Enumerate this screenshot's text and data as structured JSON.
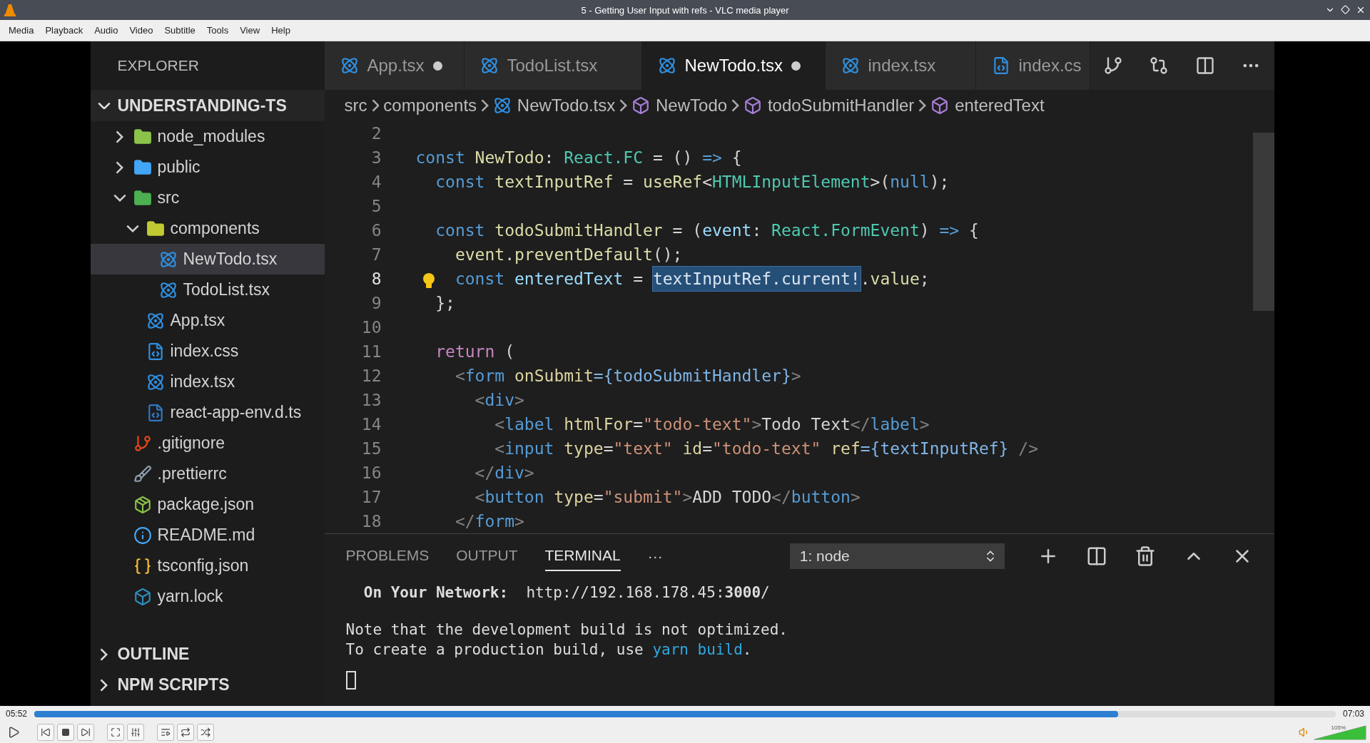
{
  "window": {
    "title": "5 - Getting User Input with refs - VLC media player"
  },
  "menu": [
    "Media",
    "Playback",
    "Audio",
    "Video",
    "Subtitle",
    "Tools",
    "View",
    "Help"
  ],
  "editor": {
    "sidebar": {
      "title": "EXPLORER",
      "root": {
        "label": "UNDERSTANDING-TS",
        "expanded": true,
        "children": [
          {
            "label": "node_modules",
            "kind": "folder",
            "color": "#8bc34a",
            "expanded": false,
            "selected": false
          },
          {
            "label": "public",
            "kind": "folder",
            "color": "#42a5f5",
            "expanded": false,
            "selected": false
          },
          {
            "label": "src",
            "kind": "folder",
            "color": "#4caf50",
            "expanded": true,
            "selected": false,
            "children": [
              {
                "label": "components",
                "kind": "folder",
                "color": "#c0ca33",
                "expanded": true,
                "selected": false,
                "children": [
                  {
                    "label": "NewTodo.tsx",
                    "kind": "react",
                    "selected": true
                  },
                  {
                    "label": "TodoList.tsx",
                    "kind": "react",
                    "selected": false
                  }
                ]
              },
              {
                "label": "App.tsx",
                "kind": "react",
                "selected": false
              },
              {
                "label": "index.css",
                "kind": "css",
                "selected": false
              },
              {
                "label": "index.tsx",
                "kind": "react",
                "selected": false
              },
              {
                "label": "react-app-env.d.ts",
                "kind": "ts",
                "selected": false
              }
            ]
          },
          {
            "label": ".gitignore",
            "kind": "git",
            "selected": false
          },
          {
            "label": ".prettierrc",
            "kind": "prettier",
            "selected": false
          },
          {
            "label": "package.json",
            "kind": "npm",
            "selected": false
          },
          {
            "label": "README.md",
            "kind": "info",
            "selected": false
          },
          {
            "label": "tsconfig.json",
            "kind": "json",
            "selected": false
          },
          {
            "label": "yarn.lock",
            "kind": "yarn",
            "selected": false
          }
        ]
      },
      "sections": [
        {
          "label": "OUTLINE",
          "expanded": false
        },
        {
          "label": "NPM SCRIPTS",
          "expanded": false
        }
      ]
    },
    "tabs": [
      {
        "label": "App.tsx",
        "kind": "react",
        "selected": false,
        "modified": true
      },
      {
        "label": "TodoList.tsx",
        "kind": "react",
        "selected": false,
        "modified": false
      },
      {
        "label": "NewTodo.tsx",
        "kind": "react",
        "selected": true,
        "modified": true
      },
      {
        "label": "index.tsx",
        "kind": "react",
        "selected": false,
        "modified": false
      },
      {
        "label": "index.cs",
        "kind": "css",
        "selected": false
      }
    ],
    "breadcrumb": [
      {
        "label": "src",
        "kind": "folder"
      },
      {
        "label": "components",
        "kind": "folder"
      },
      {
        "label": "NewTodo.tsx",
        "kind": "react"
      },
      {
        "label": "NewTodo",
        "kind": "symbol"
      },
      {
        "label": "todoSubmitHandler",
        "kind": "symbol"
      },
      {
        "label": "enteredText",
        "kind": "symbol"
      }
    ],
    "code": [
      {
        "number": "2",
        "current": false
      },
      {
        "number": "3",
        "current": false,
        "tokens": [
          {
            "text": "const",
            "kind": "kw"
          },
          {
            "text": " NewTodo",
            "kind": "name"
          },
          {
            "text": ": ",
            "kind": "punct"
          },
          {
            "text": "React.FC",
            "kind": "type"
          },
          {
            "text": " = () ",
            "kind": "punct"
          },
          {
            "text": "=>",
            "kind": "kw"
          },
          {
            "text": " {",
            "kind": "punct"
          }
        ]
      },
      {
        "number": "4",
        "current": false,
        "tokens": [
          {
            "text": "  const",
            "kind": "kw"
          },
          {
            "text": " textInputRef",
            "kind": "name"
          },
          {
            "text": " = ",
            "kind": "punct"
          },
          {
            "text": "useRef",
            "kind": "name"
          },
          {
            "text": "<",
            "kind": "punct"
          },
          {
            "text": "HTMLInputElement",
            "kind": "type"
          },
          {
            "text": ">(",
            "kind": "punct"
          },
          {
            "text": "null",
            "kind": "kw"
          },
          {
            "text": ");",
            "kind": "punct"
          }
        ]
      },
      {
        "number": "5",
        "current": false
      },
      {
        "number": "6",
        "current": false,
        "tokens": [
          {
            "text": "  const",
            "kind": "kw"
          },
          {
            "text": " todoSubmitHandler",
            "kind": "name"
          },
          {
            "text": " = (",
            "kind": "punct"
          },
          {
            "text": "event",
            "kind": "var"
          },
          {
            "text": ": ",
            "kind": "punct"
          },
          {
            "text": "React.FormEvent",
            "kind": "type"
          },
          {
            "text": ") ",
            "kind": "punct"
          },
          {
            "text": "=>",
            "kind": "kw"
          },
          {
            "text": " {",
            "kind": "punct"
          }
        ]
      },
      {
        "number": "7",
        "current": false,
        "tokens": [
          {
            "text": "    event",
            "kind": "name"
          },
          {
            "text": ".",
            "kind": "punct"
          },
          {
            "text": "preventDefault",
            "kind": "name"
          },
          {
            "text": "();",
            "kind": "punct"
          }
        ]
      },
      {
        "number": "8",
        "current": true,
        "lightbulb": true,
        "tokens": [
          {
            "text": "    const",
            "kind": "kw"
          },
          {
            "text": " enteredText",
            "kind": "var"
          },
          {
            "text": " = ",
            "kind": "punct"
          },
          {
            "text": "textInputRef.current!",
            "kind": "sel"
          },
          {
            "text": ".",
            "kind": "punct"
          },
          {
            "text": "value",
            "kind": "name"
          },
          {
            "text": ";",
            "kind": "punct"
          }
        ]
      },
      {
        "number": "9",
        "current": false,
        "tokens": [
          {
            "text": "  };",
            "kind": "punct"
          }
        ]
      },
      {
        "number": "10",
        "current": false
      },
      {
        "number": "11",
        "current": false,
        "tokens": [
          {
            "text": "  return",
            "kind": "ctrl"
          },
          {
            "text": " (",
            "kind": "punct"
          }
        ]
      },
      {
        "number": "12",
        "current": false,
        "tokens": [
          {
            "text": "    <",
            "kind": "bracket"
          },
          {
            "text": "form",
            "kind": "tag"
          },
          {
            "text": " onSubmit",
            "kind": "attr"
          },
          {
            "text": "={todoSubmitHandler}",
            "kind": "brace"
          },
          {
            "text": ">",
            "kind": "bracket"
          }
        ]
      },
      {
        "number": "13",
        "current": false,
        "tokens": [
          {
            "text": "      <",
            "kind": "bracket"
          },
          {
            "text": "div",
            "kind": "tag"
          },
          {
            "text": ">",
            "kind": "bracket"
          }
        ]
      },
      {
        "number": "14",
        "current": false,
        "tokens": [
          {
            "text": "        <",
            "kind": "bracket"
          },
          {
            "text": "label",
            "kind": "tag"
          },
          {
            "text": " htmlFor",
            "kind": "attr"
          },
          {
            "text": "=",
            "kind": "punct"
          },
          {
            "text": "\"todo-text\"",
            "kind": "str"
          },
          {
            "text": ">",
            "kind": "bracket"
          },
          {
            "text": "Todo Text",
            "kind": "text"
          },
          {
            "text": "</",
            "kind": "bracket"
          },
          {
            "text": "label",
            "kind": "tag"
          },
          {
            "text": ">",
            "kind": "bracket"
          }
        ]
      },
      {
        "number": "15",
        "current": false,
        "tokens": [
          {
            "text": "        <",
            "kind": "bracket"
          },
          {
            "text": "input",
            "kind": "tag"
          },
          {
            "text": " type",
            "kind": "attr"
          },
          {
            "text": "=",
            "kind": "punct"
          },
          {
            "text": "\"text\"",
            "kind": "str"
          },
          {
            "text": " id",
            "kind": "attr"
          },
          {
            "text": "=",
            "kind": "punct"
          },
          {
            "text": "\"todo-text\"",
            "kind": "str"
          },
          {
            "text": " ref",
            "kind": "attr"
          },
          {
            "text": "={textInputRef}",
            "kind": "brace"
          },
          {
            "text": " />",
            "kind": "bracket"
          }
        ]
      },
      {
        "number": "16",
        "current": false,
        "tokens": [
          {
            "text": "      </",
            "kind": "bracket"
          },
          {
            "text": "div",
            "kind": "tag"
          },
          {
            "text": ">",
            "kind": "bracket"
          }
        ]
      },
      {
        "number": "17",
        "current": false,
        "tokens": [
          {
            "text": "      <",
            "kind": "bracket"
          },
          {
            "text": "button",
            "kind": "tag"
          },
          {
            "text": " type",
            "kind": "attr"
          },
          {
            "text": "=",
            "kind": "punct"
          },
          {
            "text": "\"submit\"",
            "kind": "str"
          },
          {
            "text": ">",
            "kind": "bracket"
          },
          {
            "text": "ADD TODO",
            "kind": "text"
          },
          {
            "text": "</",
            "kind": "bracket"
          },
          {
            "text": "button",
            "kind": "tag"
          },
          {
            "text": ">",
            "kind": "bracket"
          }
        ]
      },
      {
        "number": "18",
        "current": false,
        "tokens": [
          {
            "text": "    </",
            "kind": "bracket"
          },
          {
            "text": "form",
            "kind": "tag"
          },
          {
            "text": ">",
            "kind": "bracket"
          }
        ]
      }
    ],
    "panel": {
      "tabs": [
        {
          "label": "PROBLEMS",
          "selected": false
        },
        {
          "label": "OUTPUT",
          "selected": false
        },
        {
          "label": "TERMINAL",
          "selected": true
        }
      ],
      "more": "···",
      "terminal": "1: node",
      "lines": [
        {
          "segments": [
            {
              "text": "  **On Your Network:**  http://192.168.178.45:**3000**/",
              "kind": "plain"
            }
          ]
        },
        {
          "segments": [
            {
              "text": "Note that the development build is not optimized.",
              "kind": "plain"
            }
          ]
        },
        {
          "segments": [
            {
              "text": "To create a production build, use ",
              "kind": "plain"
            },
            {
              "text": "yarn build",
              "kind": "link"
            },
            {
              "text": ".",
              "kind": "plain"
            }
          ]
        }
      ]
    }
  },
  "player": {
    "elapsed": "05:52",
    "total": "07:03",
    "level": 0.833,
    "volume": {
      "reading": "105%",
      "level": 1
    }
  }
}
